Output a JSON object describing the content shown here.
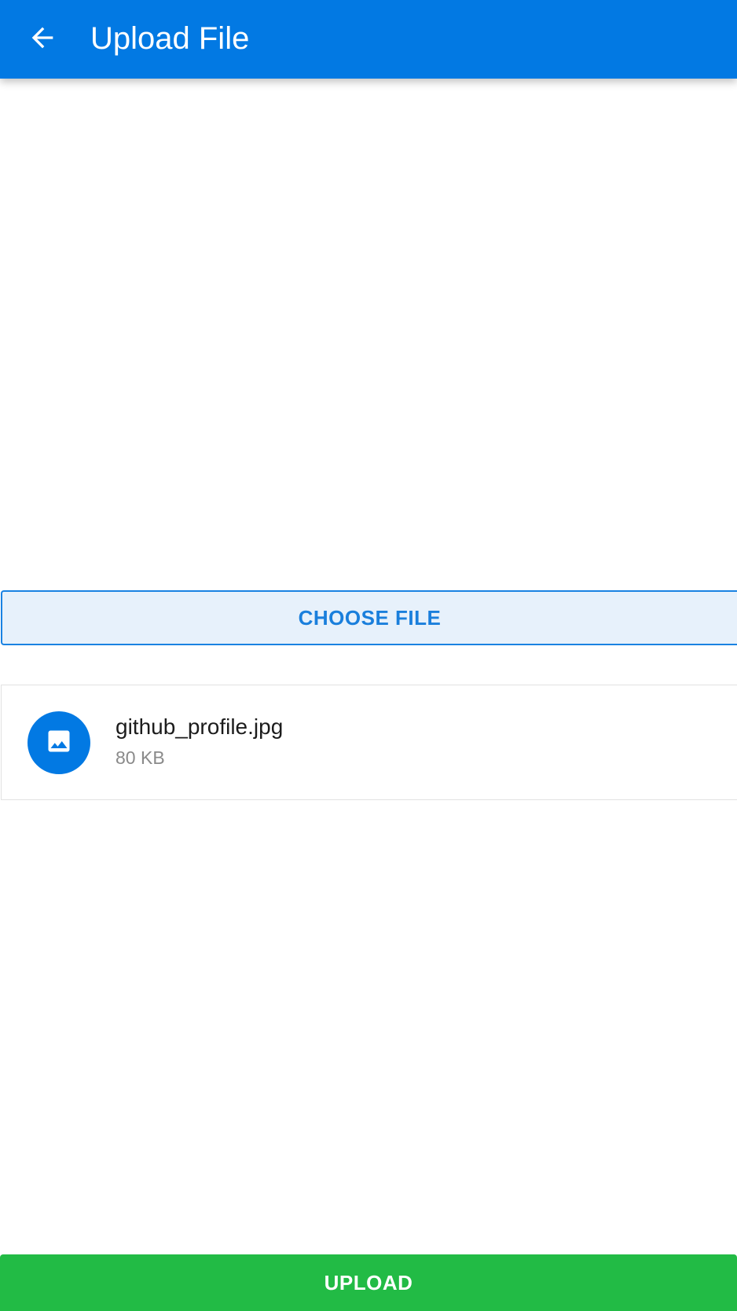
{
  "app_bar": {
    "title": "Upload File",
    "back_icon": "arrow-back-icon",
    "color": "#0279e3"
  },
  "choose_file": {
    "label": "CHOOSE FILE"
  },
  "selected_file": {
    "icon": "image-icon",
    "name": "github_profile.jpg",
    "size": "80 KB"
  },
  "upload": {
    "label": "UPLOAD",
    "color": "#22bb45"
  }
}
